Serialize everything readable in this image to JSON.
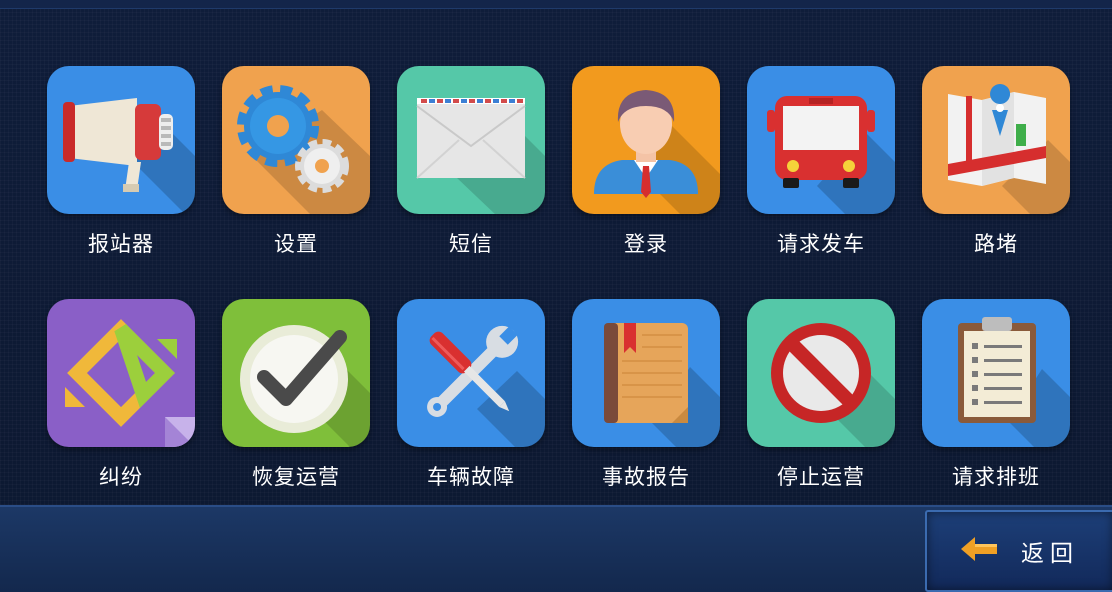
{
  "tiles": [
    {
      "label": "报站器",
      "icon": "megaphone-icon",
      "bg": "#3a8ee6"
    },
    {
      "label": "设置",
      "icon": "gear-icon",
      "bg": "#f0a24e"
    },
    {
      "label": "短信",
      "icon": "envelope-icon",
      "bg": "#55c8a8"
    },
    {
      "label": "登录",
      "icon": "user-icon",
      "bg": "#f29a1e"
    },
    {
      "label": "请求发车",
      "icon": "bus-icon",
      "bg": "#3a8ee6"
    },
    {
      "label": "路堵",
      "icon": "map-icon",
      "bg": "#f0a24e"
    },
    {
      "label": "纠纷",
      "icon": "exchange-icon",
      "bg": "#8a5fc7"
    },
    {
      "label": "恢复运营",
      "icon": "checkmark-icon",
      "bg": "#7fbf3a"
    },
    {
      "label": "车辆故障",
      "icon": "wrench-screwdriver-icon",
      "bg": "#3a8ee6"
    },
    {
      "label": "事故报告",
      "icon": "book-icon",
      "bg": "#3a8ee6"
    },
    {
      "label": "停止运营",
      "icon": "prohibited-icon",
      "bg": "#55c8a8"
    },
    {
      "label": "请求排班",
      "icon": "clipboard-icon",
      "bg": "#3a8ee6"
    }
  ],
  "footer": {
    "back_label": "返回",
    "back_icon": "arrow-left-icon"
  }
}
